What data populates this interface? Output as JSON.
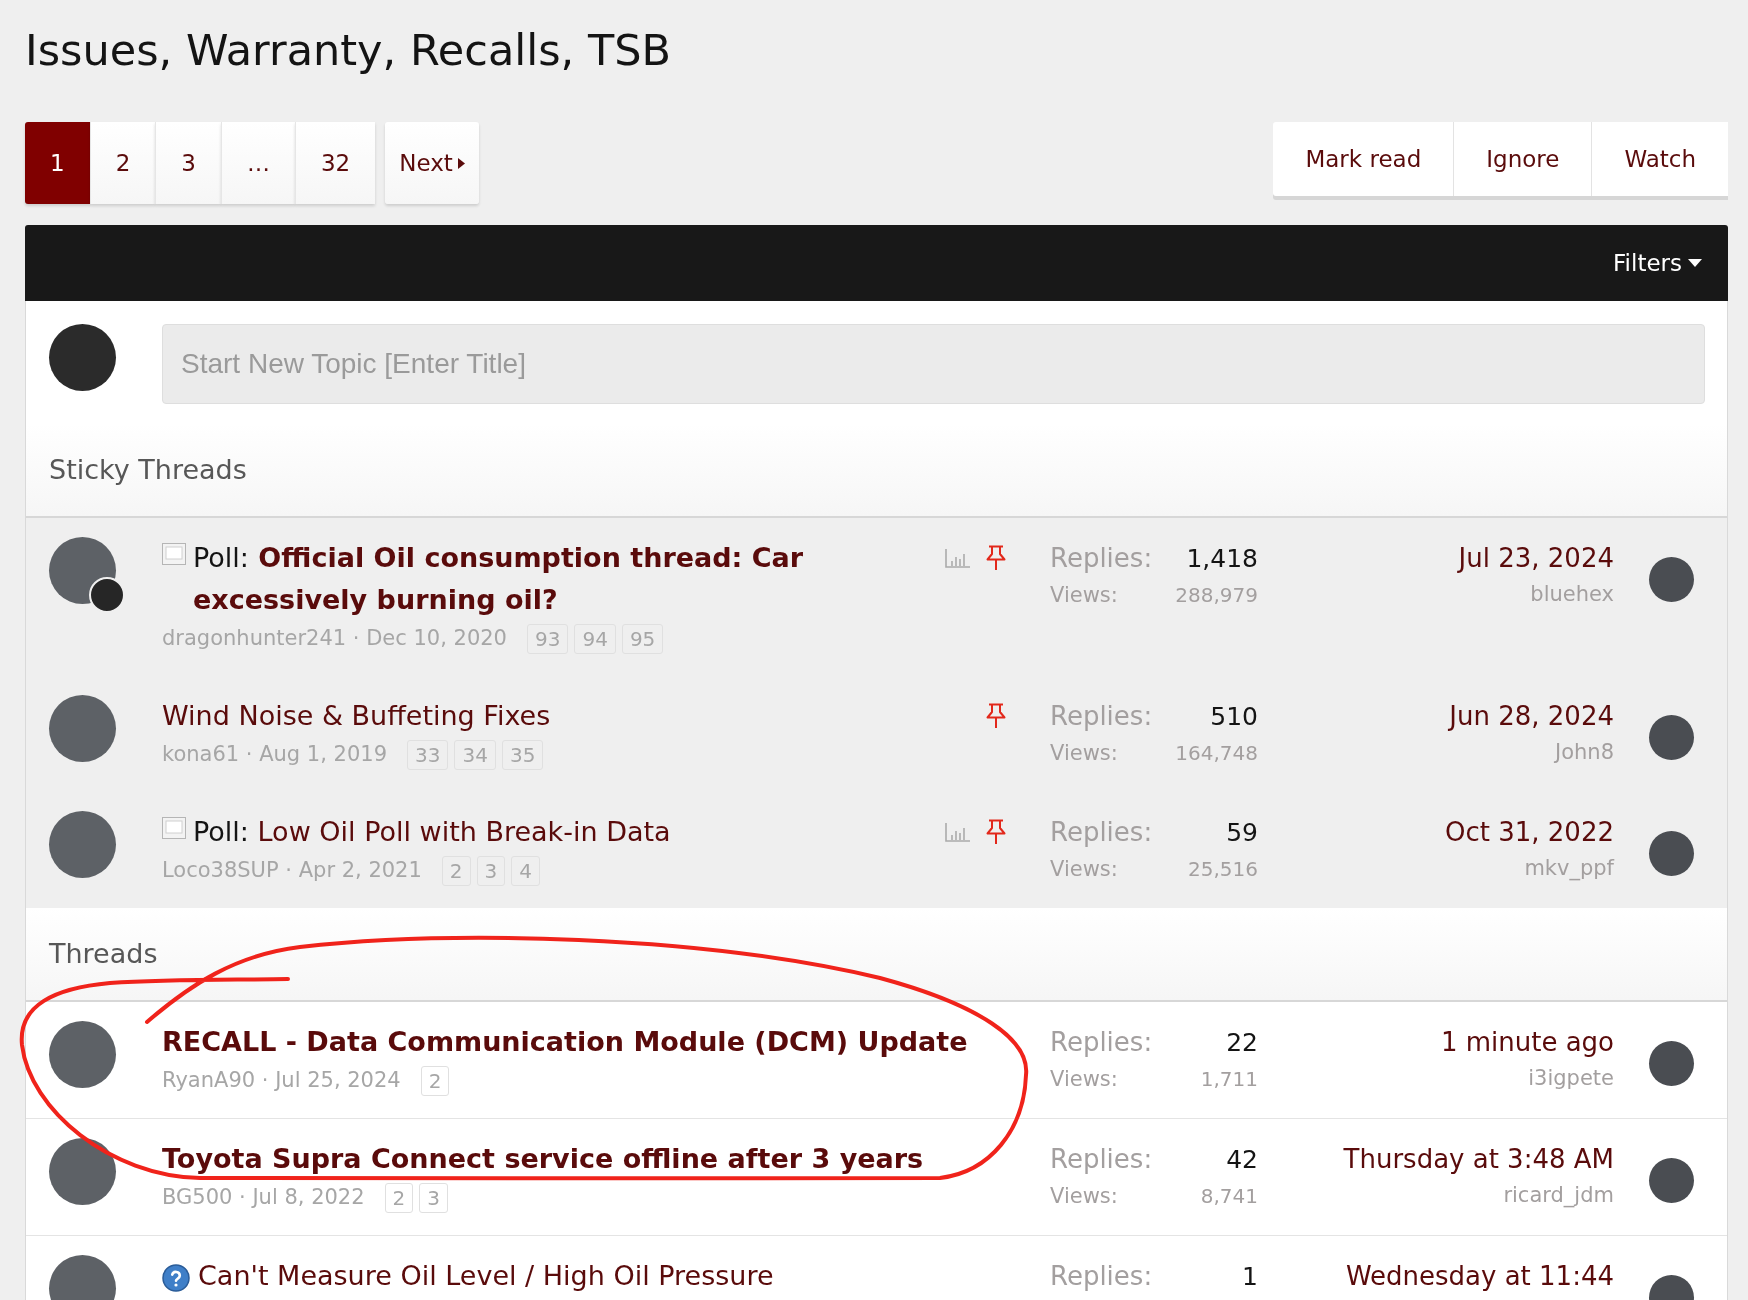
{
  "page_title": "Issues, Warranty, Recalls, TSB",
  "pagination": {
    "pages": [
      {
        "label": "1",
        "selected": true
      },
      {
        "label": "2",
        "selected": false
      },
      {
        "label": "3",
        "selected": false
      },
      {
        "label": "…",
        "selected": false
      },
      {
        "label": "32",
        "selected": false
      }
    ],
    "next": "Next"
  },
  "actions": [
    "Mark read",
    "Ignore",
    "Watch"
  ],
  "filter_bar": {
    "filters": "Filters"
  },
  "new_topic": {
    "placeholder": "Start New Topic [Enter Title]"
  },
  "sections": [
    {
      "title": "Sticky Threads",
      "sticky": true,
      "threads": [
        {
          "kind": "poll",
          "prefix": "Poll:",
          "title": "Official Oil consumption thread: Car excessively burning oil?",
          "unread": true,
          "byline": "dragonhunter241 · Dec 10, 2020",
          "pages": [
            "93",
            "94",
            "95"
          ],
          "pinned": true,
          "second_avatar": true,
          "replies_label": "Replies:",
          "replies": "1,418",
          "views_label": "Views:",
          "views": "288,979",
          "last_date": "Jul 23, 2024",
          "last_user": "bluehex"
        },
        {
          "kind": "plain",
          "title": "Wind Noise & Buffeting Fixes",
          "unread": false,
          "byline": "kona61 · Aug 1, 2019",
          "pages": [
            "33",
            "34",
            "35"
          ],
          "pinned": true,
          "second_avatar": false,
          "replies_label": "Replies:",
          "replies": "510",
          "views_label": "Views:",
          "views": "164,748",
          "last_date": "Jun 28, 2024",
          "last_user": "John8"
        },
        {
          "kind": "poll",
          "prefix": "Poll:",
          "title": "Low Oil Poll with Break-in Data",
          "unread": false,
          "byline": "Loco38SUP · Apr 2, 2021",
          "pages": [
            "2",
            "3",
            "4"
          ],
          "pinned": true,
          "second_avatar": false,
          "replies_label": "Replies:",
          "replies": "59",
          "views_label": "Views:",
          "views": "25,516",
          "last_date": "Oct 31, 2022",
          "last_user": "mkv_ppf"
        }
      ]
    },
    {
      "title": "Threads",
      "sticky": false,
      "threads": [
        {
          "kind": "plain",
          "title": "RECALL - Data Communication Module (DCM) Update",
          "unread": true,
          "byline": "RyanA90 · Jul 25, 2024",
          "pages": [
            "2"
          ],
          "pinned": false,
          "second_avatar": false,
          "replies_label": "Replies:",
          "replies": "22",
          "views_label": "Views:",
          "views": "1,711",
          "last_date": "1 minute ago",
          "last_user": "i3igpete"
        },
        {
          "kind": "plain",
          "title": "Toyota Supra Connect service offline after 3 years",
          "unread": true,
          "byline": "BG500 · Jul 8, 2022",
          "pages": [
            "2",
            "3"
          ],
          "pinned": false,
          "second_avatar": false,
          "replies_label": "Replies:",
          "replies": "42",
          "views_label": "Views:",
          "views": "8,741",
          "last_date": "Thursday at 3:48 AM",
          "last_user": "ricard_jdm"
        },
        {
          "kind": "question",
          "title": "Can't Measure Oil Level / High Oil Pressure",
          "unread": false,
          "pinned": false,
          "second_avatar": false,
          "replies_label": "Replies:",
          "replies": "1",
          "last_date": "Wednesday at 11:44"
        }
      ]
    }
  ]
}
